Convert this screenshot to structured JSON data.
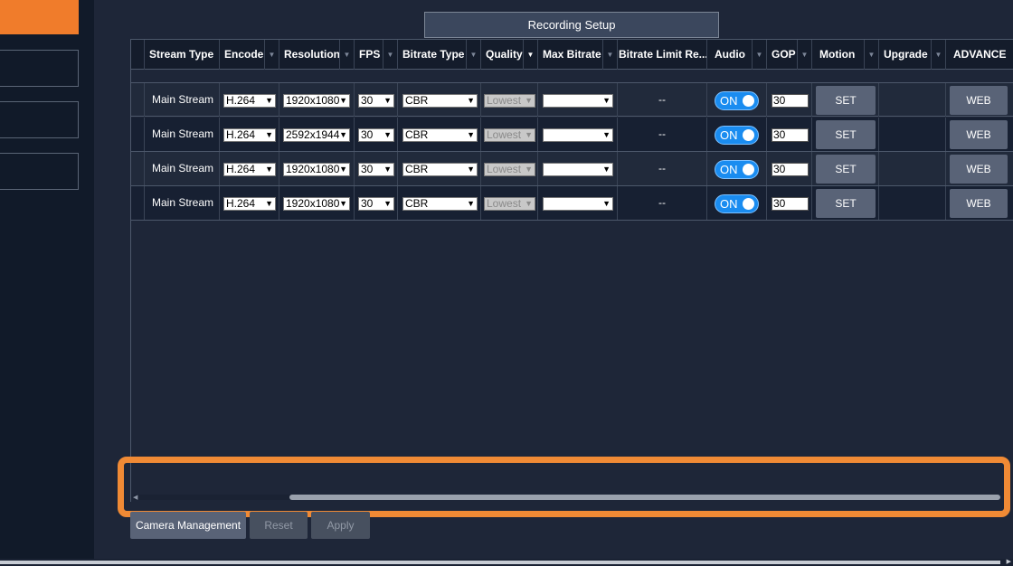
{
  "title": "Recording Setup",
  "columns": {
    "stream_type": "Stream Type",
    "encode": "Encode",
    "resolution": "Resolution",
    "fps": "FPS",
    "bitrate_type": "Bitrate Type",
    "quality": "Quality",
    "max_bitrate": "Max Bitrate",
    "bitrate_limit": "Bitrate Limit Re...",
    "audio": "Audio",
    "gop": "GOP",
    "motion": "Motion",
    "upgrade": "Upgrade",
    "advance": "ADVANCE"
  },
  "rows": [
    {
      "stream": "Main Stream",
      "encode": "H.264",
      "resolution": "1920x1080",
      "fps": "30",
      "bitrate_type": "CBR",
      "quality": "Lowest",
      "max_bitrate": "",
      "bitrate_limit": "--",
      "audio": "ON",
      "gop": "30",
      "motion": "SET",
      "advance": "WEB"
    },
    {
      "stream": "Main Stream",
      "encode": "H.264",
      "resolution": "2592x1944",
      "fps": "30",
      "bitrate_type": "CBR",
      "quality": "Lowest",
      "max_bitrate": "",
      "bitrate_limit": "--",
      "audio": "ON",
      "gop": "30",
      "motion": "SET",
      "advance": "WEB"
    },
    {
      "stream": "Main Stream",
      "encode": "H.264",
      "resolution": "1920x1080",
      "fps": "30",
      "bitrate_type": "CBR",
      "quality": "Lowest",
      "max_bitrate": "",
      "bitrate_limit": "--",
      "audio": "ON",
      "gop": "30",
      "motion": "SET",
      "advance": "WEB"
    },
    {
      "stream": "Main Stream",
      "encode": "H.264",
      "resolution": "1920x1080",
      "fps": "30",
      "bitrate_type": "CBR",
      "quality": "Lowest",
      "max_bitrate": "",
      "bitrate_limit": "--",
      "audio": "ON",
      "gop": "30",
      "motion": "SET",
      "advance": "WEB"
    }
  ],
  "footer": {
    "camera_management": "Camera Management",
    "reset": "Reset",
    "apply": "Apply"
  },
  "icons": {
    "dropdown": "chevron-down-icon",
    "scroll_left": "arrow-left-icon",
    "scroll_right": "arrow-right-icon"
  },
  "colors": {
    "accent": "#f07c2b",
    "toggle_on": "#1a8cf0",
    "highlight": "#f08a35"
  }
}
